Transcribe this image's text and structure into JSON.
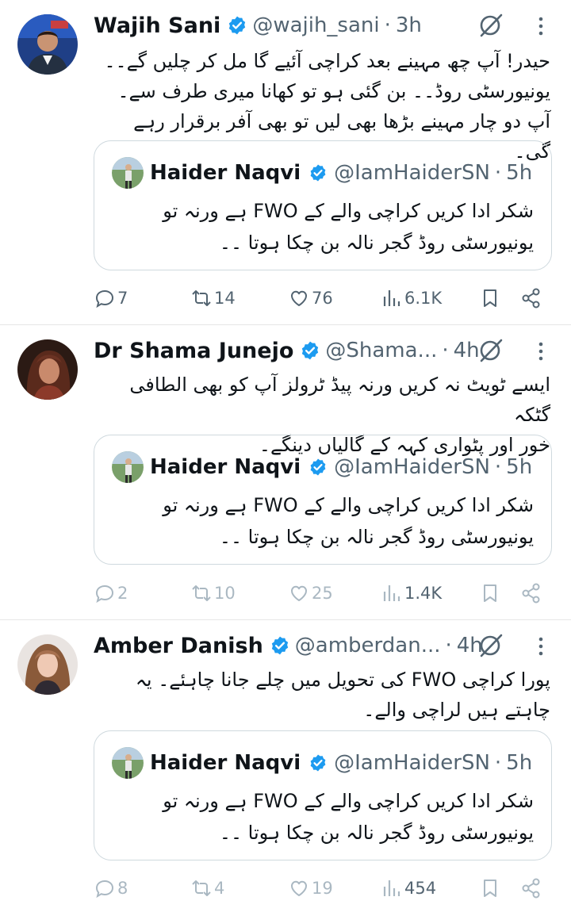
{
  "colors": {
    "verified_blue": "#1d9bf0",
    "text_primary": "#0f1419",
    "text_secondary": "#536471",
    "border": "#cfd9de",
    "divider": "#e6e6e6"
  },
  "tweets": [
    {
      "author": {
        "name": "Wajih Sani",
        "handle": "@wajih_sani",
        "time": "3h",
        "verified": true
      },
      "body_lines": [
        "حیدر! آپ چھ مہینے بعد کراچی آئیے گا مل کر چلیں گے۔۔",
        "یونیورسٹی روڈ۔۔ بن گئی ہو تو کھانا میری طرف سے۔",
        "آپ دو چار مہینے بڑھا بھی لیں تو بھی آفر برقرار رہے گی۔"
      ],
      "quote": {
        "author": {
          "name": "Haider Naqvi",
          "handle": "@IamHaiderSN",
          "time": "5h"
        },
        "text_lines": [
          "شکر ادا کریں کراچی والے کے FWO ہے ورنہ تو",
          "یونیورسٹی روڈ گجر نالہ بن چکا ہوتا ۔۔"
        ]
      },
      "stats": {
        "replies": "7",
        "reposts": "14",
        "likes": "76",
        "views": "6.1K"
      },
      "icons": [
        "grok-icon",
        "more-icon",
        "reply-icon",
        "repost-icon",
        "like-icon",
        "views-icon",
        "bookmark-icon",
        "share-icon"
      ]
    },
    {
      "author": {
        "name": "Dr Shama Junejo",
        "handle": "@Shama...",
        "time": "4h",
        "verified": true
      },
      "body_lines": [
        "ایسے ٹویٹ نہ کریں ورنہ پیڈ ٹرولز آپ کو بھی الطافی گٹکہ",
        "خور اور پٹواری کہہ کے گالیاں دینگے۔"
      ],
      "quote": {
        "author": {
          "name": "Haider Naqvi",
          "handle": "@IamHaiderSN",
          "time": "5h"
        },
        "text_lines": [
          "شکر ادا کریں کراچی والے کے FWO ہے ورنہ تو",
          "یونیورسٹی روڈ گجر نالہ بن چکا ہوتا ۔۔"
        ]
      },
      "stats": {
        "replies": "2",
        "reposts": "10",
        "likes": "25",
        "views": "1.4K"
      }
    },
    {
      "author": {
        "name": "Amber Danish",
        "handle": "@amberdan...",
        "time": "4h",
        "verified": true
      },
      "body_lines": [
        "پورا کراچی FWO کی تحویل میں چلے جانا چاہئے۔ یہ",
        "چاہتے ہیں لراچی والے۔"
      ],
      "quote": {
        "author": {
          "name": "Haider Naqvi",
          "handle": "@IamHaiderSN",
          "time": "5h"
        },
        "text_lines": [
          "شکر ادا کریں کراچی والے کے FWO ہے ورنہ تو",
          "یونیورسٹی روڈ گجر نالہ بن چکا ہوتا ۔۔"
        ]
      },
      "stats": {
        "replies": "8",
        "reposts": "4",
        "likes": "19",
        "views": "454"
      }
    }
  ]
}
